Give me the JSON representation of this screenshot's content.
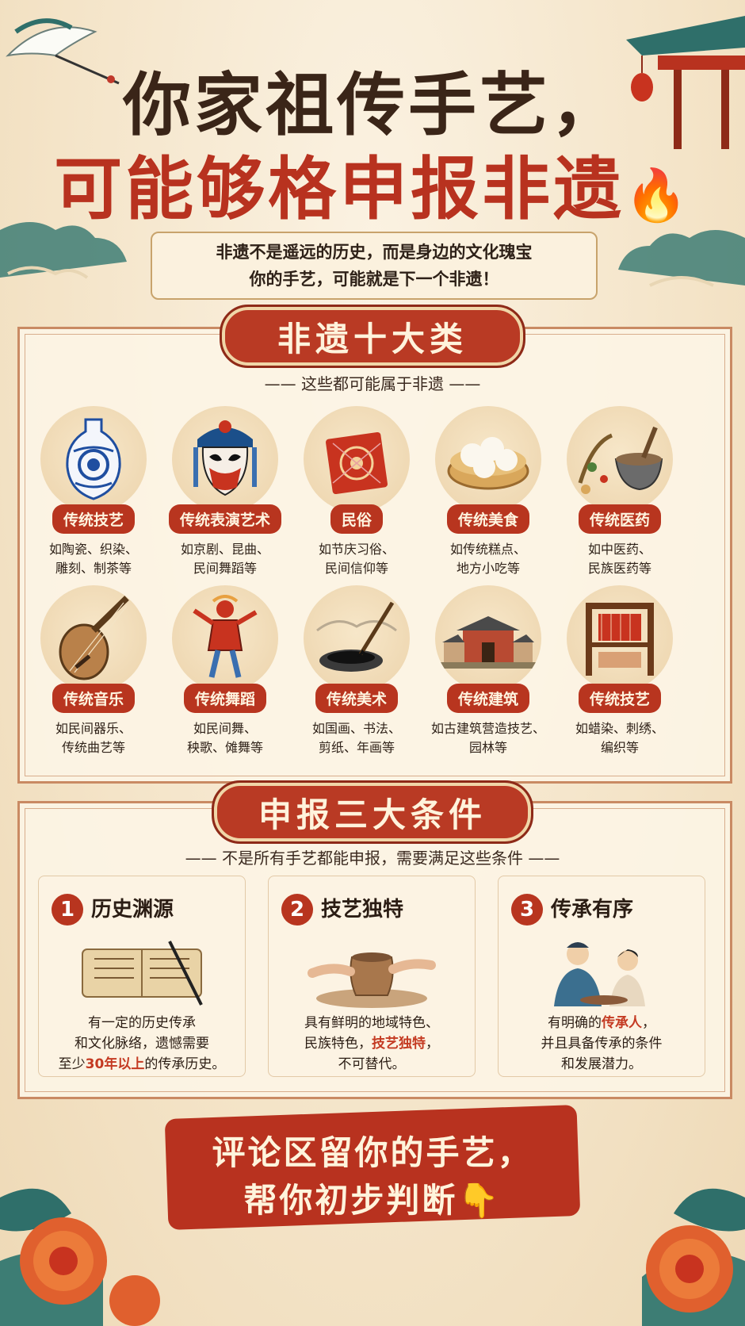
{
  "title": {
    "line1": "你家祖传手艺，",
    "line2": "可能够格申报非遗",
    "emoji": "🔥"
  },
  "subtitle": {
    "line1": "非遗不是遥远的历史，而是身边的文化瑰宝",
    "line2": "你的手艺，可能就是下一个非遗！"
  },
  "section1": {
    "banner": "非遗十大类",
    "note": "—— 这些都可能属于非遗 ——",
    "categories": [
      {
        "name": "传统技艺",
        "desc1": "如陶瓷、织染、",
        "desc2": "雕刻、制茶等",
        "icon": "vase-icon"
      },
      {
        "name": "传统表演艺术",
        "desc1": "如京剧、昆曲、",
        "desc2": "民间舞蹈等",
        "icon": "opera-mask-icon"
      },
      {
        "name": "民俗",
        "desc1": "如节庆习俗、",
        "desc2": "民间信仰等",
        "icon": "red-pouch-icon"
      },
      {
        "name": "传统美食",
        "desc1": "如传统糕点、",
        "desc2": "地方小吃等",
        "icon": "steamed-buns-icon"
      },
      {
        "name": "传统医药",
        "desc1": "如中医药、",
        "desc2": "民族医药等",
        "icon": "herb-mortar-icon"
      },
      {
        "name": "传统音乐",
        "desc1": "如民间器乐、",
        "desc2": "传统曲艺等",
        "icon": "pipa-icon"
      },
      {
        "name": "传统舞蹈",
        "desc1": "如民间舞、",
        "desc2": "秧歌、傩舞等",
        "icon": "dancer-icon"
      },
      {
        "name": "传统美术",
        "desc1": "如国画、书法、",
        "desc2": "剪纸、年画等",
        "icon": "ink-brush-icon"
      },
      {
        "name": "传统建筑",
        "desc1": "如古建筑营造技艺、",
        "desc2": "园林等",
        "icon": "building-icon"
      },
      {
        "name": "传统技艺",
        "desc1": "如蜡染、刺绣、",
        "desc2": "编织等",
        "icon": "loom-icon"
      }
    ]
  },
  "section2": {
    "banner": "申报三大条件",
    "note": "—— 不是所有手艺都能申报，需要满足这些条件 ——",
    "conditions": [
      {
        "num": "1",
        "title": "历史渊源",
        "l1": "有一定的历史传承",
        "l2": "和文化脉络，遗憾需要",
        "l3a": "至少",
        "l3b": "30年以上",
        "l3c": "的传承历史。",
        "icon": "scroll-book-icon"
      },
      {
        "num": "2",
        "title": "技艺独特",
        "l1": "具有鲜明的地域特色、",
        "l2a": "民族特色，",
        "l2b": "技艺独特",
        "l2c": "，",
        "l3": "不可替代。",
        "icon": "pottery-wheel-icon"
      },
      {
        "num": "3",
        "title": "传承有序",
        "l1a": "有明确的",
        "l1b": "传承人",
        "l1c": "，",
        "l2": "并且具备传承的条件",
        "l3": "和发展潜力。",
        "icon": "master-apprentice-icon"
      }
    ]
  },
  "cta": {
    "line1": "评论区留你的手艺，",
    "line2": "帮你初步判断👇"
  },
  "colors": {
    "accent": "#b8321f",
    "dark": "#3a2518",
    "paper": "#f7ead3",
    "teal": "#2f6f6a"
  }
}
